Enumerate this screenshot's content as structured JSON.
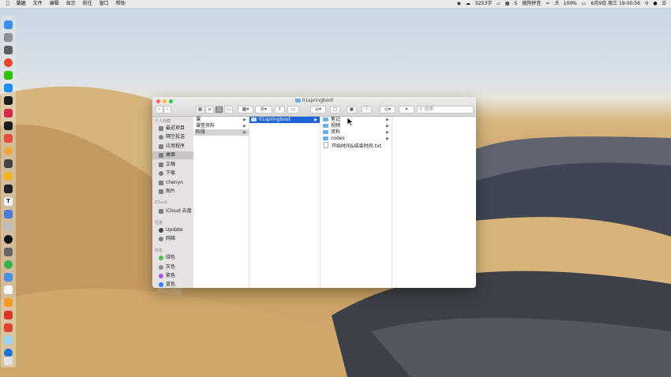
{
  "menubar": {
    "app_name": "访达",
    "menus": [
      "文件",
      "编辑",
      "显示",
      "前往",
      "窗口",
      "帮助"
    ],
    "status": {
      "word_count": "3253字",
      "input_method": "搜狗拼音",
      "battery": "100%",
      "datetime": "6月9日 周三  19:00:56"
    }
  },
  "window": {
    "title": "01springboot",
    "search_placeholder": "搜索"
  },
  "sidebar": {
    "sections": [
      {
        "header": "个人收藏",
        "items": [
          "最近项目",
          "隔空投送",
          "应用程序",
          "桌面",
          "文稿",
          "下载",
          "chenyn",
          "图片"
        ]
      },
      {
        "header": "iCloud",
        "items": [
          "iCloud 云盘"
        ]
      },
      {
        "header": "位置",
        "items": [
          "Update",
          "网络"
        ]
      },
      {
        "header": "标签",
        "items": [
          "绿色",
          "灰色",
          "紫色",
          "蓝色"
        ]
      }
    ],
    "active_item": "桌面",
    "tag_colors": {
      "绿色": "#4cc443",
      "灰色": "#8e8e8e",
      "紫色": "#a55bd8",
      "蓝色": "#2f7cf6"
    }
  },
  "columns": [
    {
      "items": [
        "课",
        "课堂资料",
        "阶段"
      ],
      "selected": "阶段"
    },
    {
      "items": [
        "01springboot"
      ],
      "selected": "01springboot"
    },
    {
      "items": [
        "笔记",
        "视频",
        "资料",
        "codes",
        "开始时间&结束时间.txt"
      ]
    }
  ],
  "colors": {
    "selection_blue": "#1f63d8"
  }
}
